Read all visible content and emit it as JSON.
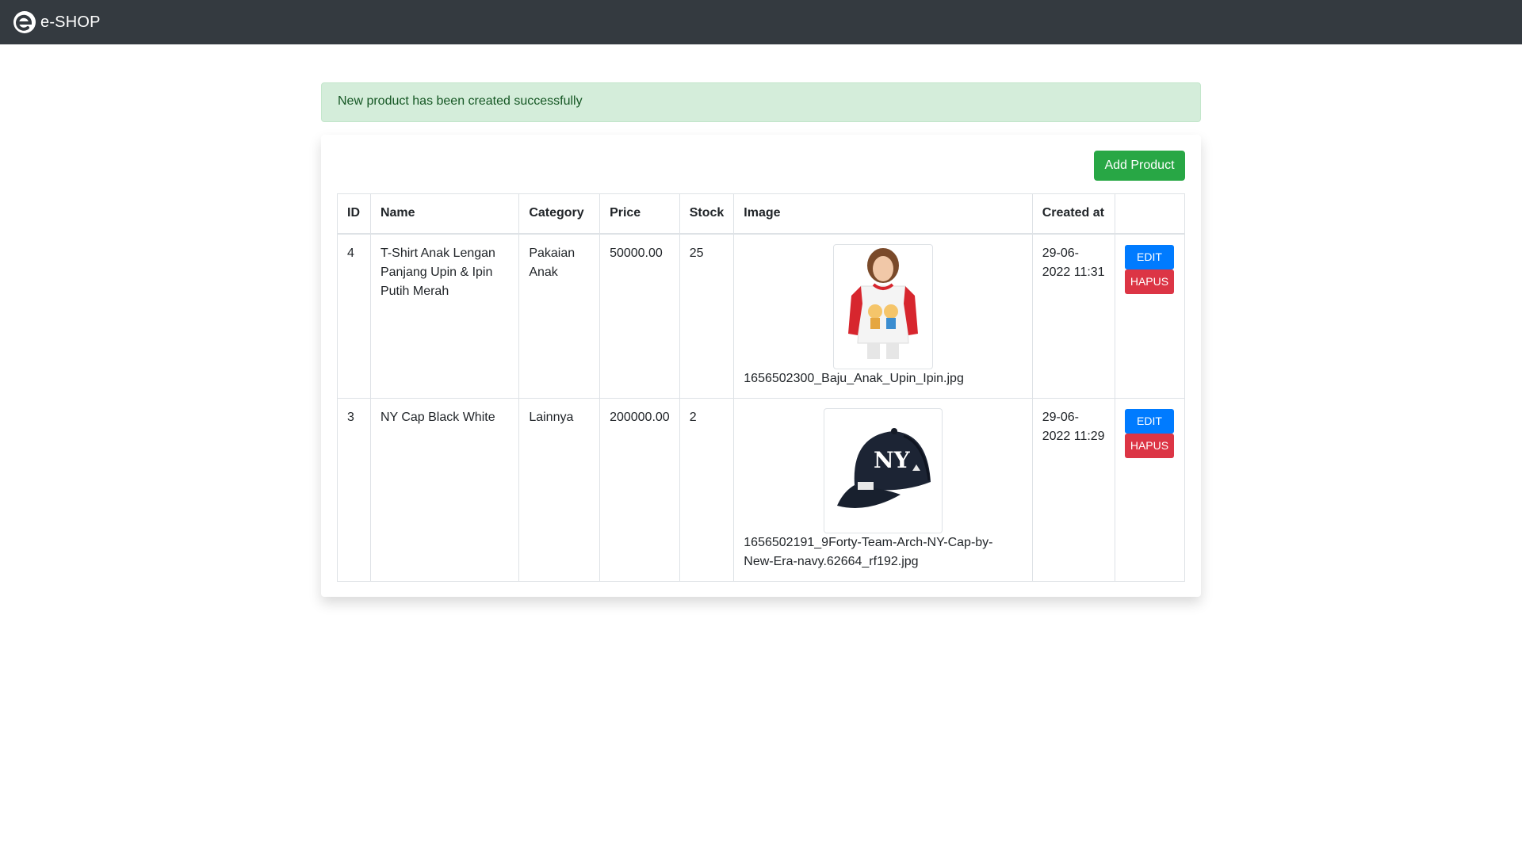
{
  "navbar": {
    "brand": "e-SHOP",
    "logo_icon": "eshop-logo-icon"
  },
  "alert": {
    "message": "New product has been created successfully"
  },
  "toolbar": {
    "add_label": "Add Product"
  },
  "table": {
    "headers": [
      "ID",
      "Name",
      "Category",
      "Price",
      "Stock",
      "Image",
      "Created at",
      ""
    ],
    "rows": [
      {
        "id": "4",
        "name": "T-Shirt Anak Lengan Panjang Upin & Ipin Putih Merah",
        "category": "Pakaian Anak",
        "price": "50000.00",
        "stock": "25",
        "image_file": "1656502300_Baju_Anak_Upin_Ipin.jpg",
        "created_at": "29-06-2022 11:31",
        "edit_label": "EDIT",
        "delete_label": "HAPUS"
      },
      {
        "id": "3",
        "name": "NY Cap Black White",
        "category": "Lainnya",
        "price": "200000.00",
        "stock": "2",
        "image_file": "1656502191_9Forty-Team-Arch-NY-Cap-by-New-Era-navy.62664_rf192.jpg",
        "created_at": "29-06-2022 11:29",
        "edit_label": "EDIT",
        "delete_label": "HAPUS"
      }
    ]
  },
  "colors": {
    "navbar": "#343a40",
    "alert_bg": "#d4edda",
    "alert_text": "#155724",
    "add_button": "#28a745",
    "edit_button": "#007bff",
    "delete_button": "#dc3545"
  }
}
